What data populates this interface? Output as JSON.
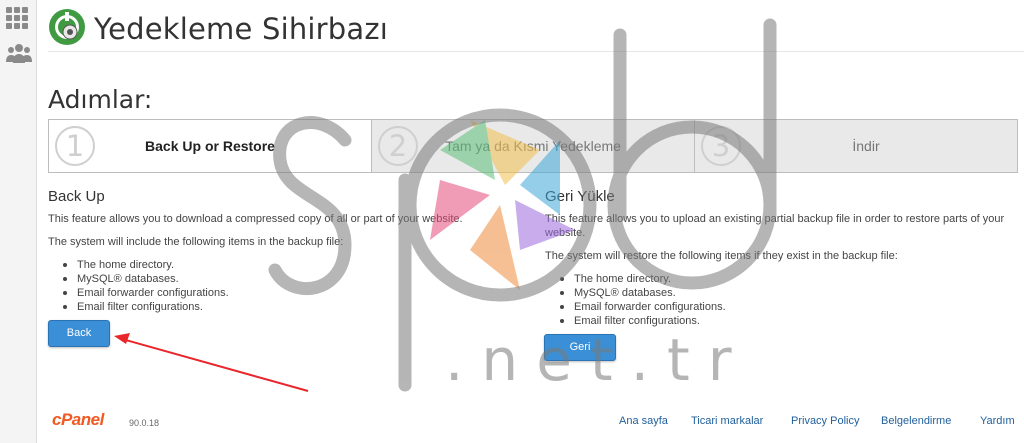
{
  "header": {
    "title": "Yedekleme Sihirbazı"
  },
  "steps_heading": "Adımlar:",
  "steps": [
    {
      "number": "1",
      "label": "Back Up or Restore",
      "active": true
    },
    {
      "number": "2",
      "label": "Tam ya da Kısmi Yedekleme",
      "active": false
    },
    {
      "number": "3",
      "label": "İndir",
      "active": false
    }
  ],
  "backup": {
    "title": "Back Up",
    "desc": "This feature allows you to download a compressed copy of all or part of your website.",
    "include_note": "The system will include the following items in the backup file:",
    "items": [
      "The home directory.",
      "MySQL® databases.",
      "Email forwarder configurations.",
      "Email filter configurations."
    ],
    "button_label": "Back Up"
  },
  "restore": {
    "title": "Geri Yükle",
    "desc": "This feature allows you to upload an existing partial backup file in order to restore parts of your website.",
    "restore_note": "The system will restore the following items if they exist in the backup file:",
    "items": [
      "The home directory.",
      "MySQL® databases.",
      "Email forwarder configurations.",
      "Email filter configurations."
    ],
    "button_label": "Geri Yükle"
  },
  "footer": {
    "logo_text": "cPanel",
    "version": "90.0.18",
    "links": [
      "Ana sayfa",
      "Ticari markalar",
      "Privacy Policy",
      "Belgelendirme",
      "Yardım"
    ]
  },
  "watermark": {
    "text": "spd",
    "subtext": ".net.tr"
  },
  "colors": {
    "accent": "#3a8fd6",
    "brand": "#f05a22",
    "annotation_arrow": "#e8262b",
    "link": "#1f5f9c"
  },
  "icons": [
    "grid-icon",
    "users-icon",
    "backup-wizard-icon",
    "annotation-arrow"
  ]
}
